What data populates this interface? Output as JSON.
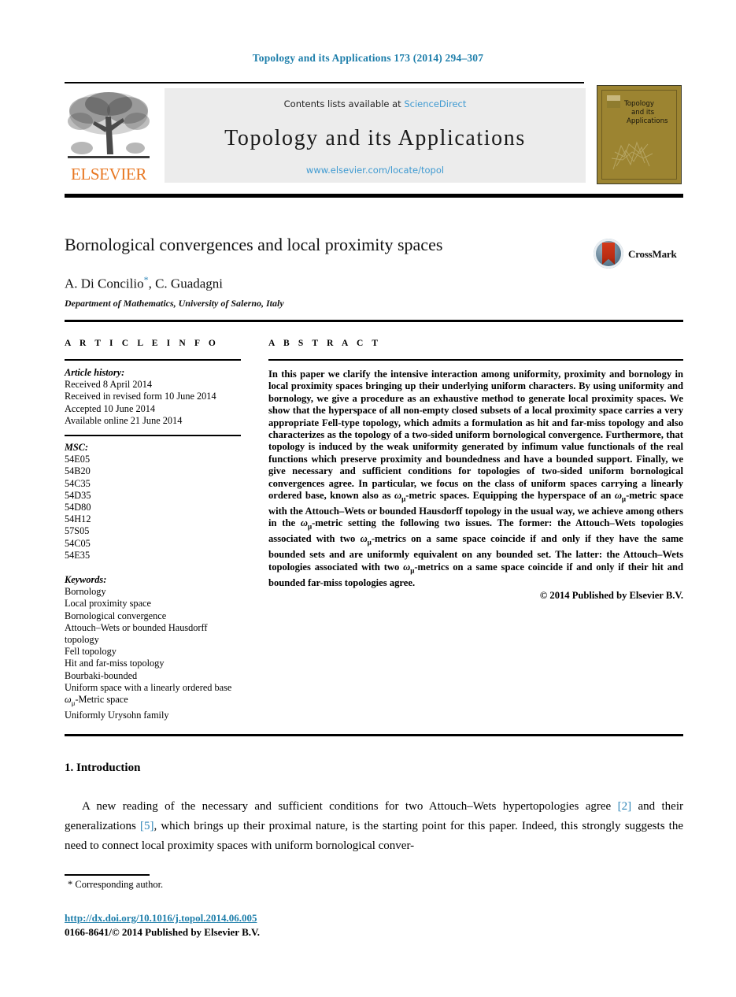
{
  "running_head": "Topology and its Applications 173 (2014) 294–307",
  "masthead": {
    "contents_prefix": "Contents lists available at ",
    "sciencedirect": "ScienceDirect",
    "journal_title": "Topology and its Applications",
    "journal_url": "www.elsevier.com/locate/topol",
    "publisher_wordmark": "ELSEVIER",
    "cover_title_line1": "Topology",
    "cover_title_line2": "and its",
    "cover_title_line3": "Applications",
    "link_color": "#3f9ad1",
    "elsevier_orange": "#e87722",
    "cover_color": "#9c8431"
  },
  "article": {
    "title": "Bornological convergences and local proximity spaces",
    "authors": "A. Di Concilio",
    "authors_marker": "*",
    "authors_rest": ", C. Guadagni",
    "affiliation": "Department of Mathematics, University of Salerno, Italy",
    "crossmark_label": "CrossMark"
  },
  "info": {
    "heading": "A R T I C L E   I N F O",
    "history_label": "Article history:",
    "history": [
      "Received 8 April 2014",
      "Received in revised form 10 June 2014",
      "Accepted 10 June 2014",
      "Available online 21 June 2014"
    ],
    "msc_label": "MSC:",
    "msc": [
      "54E05",
      "54B20",
      "54C35",
      "54D35",
      "54D80",
      "54H12",
      "57S05",
      "54C05",
      "54E35"
    ],
    "keywords_label": "Keywords:",
    "keywords": [
      "Bornology",
      "Local proximity space",
      "Bornological convergence",
      "Attouch–Wets or bounded Hausdorff topology",
      "Fell topology",
      "Hit and far-miss topology",
      "Bourbaki-bounded",
      "Uniform space with a linearly ordered base",
      "ωμ-Metric space",
      "Uniformly Urysohn family"
    ]
  },
  "abstract": {
    "heading": "A B S T R A C T",
    "text": "In this paper we clarify the intensive interaction among uniformity, proximity and bornology in local proximity spaces bringing up their underlying uniform characters. By using uniformity and bornology, we give a procedure as an exhaustive method to generate local proximity spaces. We show that the hyperspace of all non-empty closed subsets of a local proximity space carries a very appropriate Fell-type topology, which admits a formulation as hit and far-miss topology and also characterizes as the topology of a two-sided uniform bornological convergence. Furthermore, that topology is induced by the weak uniformity generated by infimum value functionals of the real functions which preserve proximity and boundedness and have a bounded support. Finally, we give necessary and sufficient conditions for topologies of two-sided uniform bornological convergences agree. In particular, we focus on the class of uniform spaces carrying a linearly ordered base, known also as ωμ-metric spaces. Equipping the hyperspace of an ωμ-metric space with the Attouch–Wets or bounded Hausdorff topology in the usual way, we achieve among others in the ωμ-metric setting the following two issues. The former: the Attouch–Wets topologies associated with two ωμ-metrics on a same space coincide if and only if they have the same bounded sets and are uniformly equivalent on any bounded set. The latter: the Attouch–Wets topologies associated with two ωμ-metrics on a same space coincide if and only if their hit and bounded far-miss topologies agree.",
    "copyright": "© 2014 Published by Elsevier B.V."
  },
  "introduction": {
    "number_title": "1.  Introduction",
    "paragraph_part1": "A new reading of the necessary and sufficient conditions for two Attouch–Wets hypertopologies agree ",
    "cite1": "[2]",
    "paragraph_part2": " and their generalizations ",
    "cite2": "[5]",
    "paragraph_part3": ", which brings up their proximal nature, is the starting point for this paper. Indeed, this strongly suggests the need to connect local proximity spaces with uniform bornological conver-"
  },
  "footer": {
    "corresponding_marker": "*",
    "corresponding": "Corresponding author.",
    "doi": "http://dx.doi.org/10.1016/j.topol.2014.06.005",
    "issn_line": "0166-8641/© 2014 Published by Elsevier B.V."
  }
}
